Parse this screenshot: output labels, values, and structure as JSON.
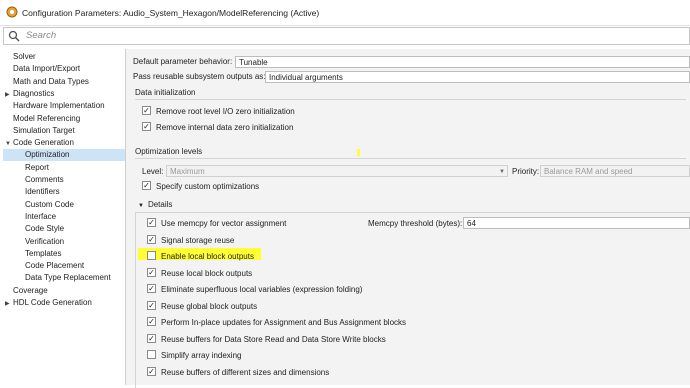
{
  "window": {
    "title": "Configuration Parameters: Audio_System_Hexagon/ModelReferencing (Active)"
  },
  "search": {
    "placeholder": "Search"
  },
  "sidebar": {
    "items": [
      {
        "label": "Solver",
        "level": 0,
        "arrow": ""
      },
      {
        "label": "Data Import/Export",
        "level": 0,
        "arrow": ""
      },
      {
        "label": "Math and Data Types",
        "level": 0,
        "arrow": ""
      },
      {
        "label": "Diagnostics",
        "level": 0,
        "arrow": "▶"
      },
      {
        "label": "Hardware Implementation",
        "level": 0,
        "arrow": ""
      },
      {
        "label": "Model Referencing",
        "level": 0,
        "arrow": ""
      },
      {
        "label": "Simulation Target",
        "level": 0,
        "arrow": ""
      },
      {
        "label": "Code Generation",
        "level": 0,
        "arrow": "▼"
      },
      {
        "label": "Optimization",
        "level": 1,
        "arrow": "",
        "selected": true
      },
      {
        "label": "Report",
        "level": 1,
        "arrow": ""
      },
      {
        "label": "Comments",
        "level": 1,
        "arrow": ""
      },
      {
        "label": "Identifiers",
        "level": 1,
        "arrow": ""
      },
      {
        "label": "Custom Code",
        "level": 1,
        "arrow": ""
      },
      {
        "label": "Interface",
        "level": 1,
        "arrow": ""
      },
      {
        "label": "Code Style",
        "level": 1,
        "arrow": ""
      },
      {
        "label": "Verification",
        "level": 1,
        "arrow": ""
      },
      {
        "label": "Templates",
        "level": 1,
        "arrow": ""
      },
      {
        "label": "Code Placement",
        "level": 1,
        "arrow": ""
      },
      {
        "label": "Data Type Replacement",
        "level": 1,
        "arrow": ""
      },
      {
        "label": "Coverage",
        "level": 0,
        "arrow": ""
      },
      {
        "label": "HDL Code Generation",
        "level": 0,
        "arrow": "▶"
      }
    ]
  },
  "main": {
    "default_param_label": "Default parameter behavior:",
    "default_param_value": "Tunable",
    "pass_reusable_label": "Pass reusable subsystem outputs as:",
    "pass_reusable_value": "Individual arguments",
    "data_init_header": "Data initialization",
    "data_init_options": [
      {
        "label": "Remove root level I/O zero initialization",
        "checked": true
      },
      {
        "label": "Remove internal data zero initialization",
        "checked": true
      }
    ],
    "opt_levels_header": "Optimization levels",
    "level_label": "Level:",
    "level_value": "Maximum",
    "priority_label": "Priority:",
    "priority_value": "Balance RAM and speed",
    "specify_custom_label": "Specify custom optimizations",
    "specify_custom_checked": true,
    "details_label": "Details",
    "memcpy_threshold_label": "Memcpy threshold (bytes):",
    "memcpy_threshold_value": "64",
    "details_options": [
      {
        "label": "Use memcpy for vector assignment",
        "checked": true
      },
      {
        "label": "Signal storage reuse",
        "checked": true
      },
      {
        "label": "Enable local block outputs",
        "checked": false
      },
      {
        "label": "Reuse local block outputs",
        "checked": true
      },
      {
        "label": "Eliminate superfluous local variables (expression folding)",
        "checked": true
      },
      {
        "label": "Reuse global block outputs",
        "checked": true
      },
      {
        "label": "Perform In-place updates for Assignment and Bus Assignment blocks",
        "checked": true
      },
      {
        "label": "Reuse buffers for Data Store Read and Data Store Write blocks",
        "checked": true
      },
      {
        "label": "Simplify array indexing",
        "checked": false
      },
      {
        "label": "Reuse buffers of different sizes and dimensions",
        "checked": true
      }
    ]
  },
  "colors": {
    "highlight": "#ffff33",
    "selected_bg": "#cde4f7",
    "main_bg": "#f3f3f3"
  },
  "icons": {
    "app": "simulink-gear-icon",
    "search": "magnifier-icon",
    "check": "checkmark-icon"
  }
}
